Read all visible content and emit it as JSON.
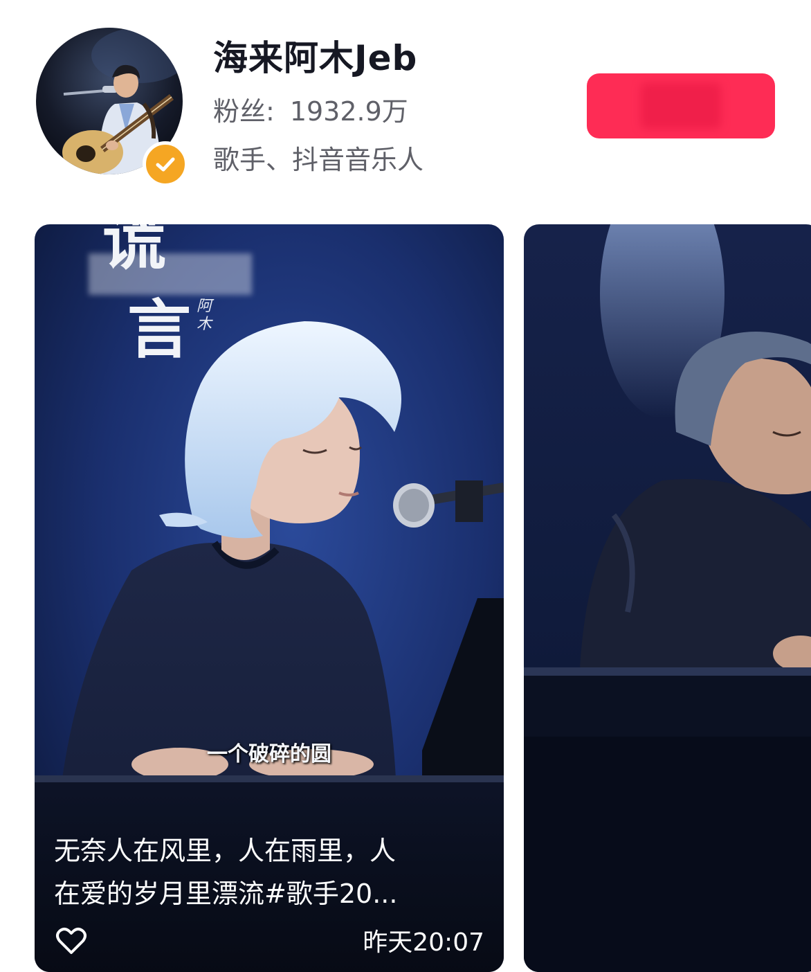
{
  "profile": {
    "name": "海来阿木Jeb",
    "fans_label": "粉丝:",
    "fans_count": "1932.9万",
    "tags": "歌手、抖音音乐人",
    "verified_icon": "check-icon",
    "follow_button_color": "#fe2c55"
  },
  "videos": [
    {
      "title_top": "谎",
      "title_char": "言",
      "artist_vertical": "阿木",
      "subtitle": "一个破碎的圆",
      "caption_line1": "无奈人在风里，人在雨里，人",
      "caption_line2": "在爱的岁月里漂流#歌手20...",
      "time": "昨天20:07",
      "like_icon": "heart-icon"
    },
    {
      "thumbnail": "performer-at-keyboard"
    }
  ],
  "colors": {
    "accent": "#fe2c55",
    "verified": "#f5a623",
    "text_primary": "#161823",
    "text_secondary": "#5f6068",
    "card_bg": "#15275a"
  }
}
